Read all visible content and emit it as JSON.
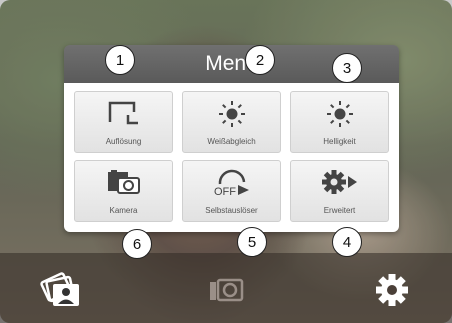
{
  "menu": {
    "title": "Menü",
    "tiles": [
      {
        "label": "Auflösung",
        "icon": "resolution-icon"
      },
      {
        "label": "Weißabgleich",
        "icon": "white-balance-icon"
      },
      {
        "label": "Helligkeit",
        "icon": "brightness-icon"
      },
      {
        "label": "Kamera",
        "icon": "camera-switch-icon"
      },
      {
        "label": "Selbstauslöser",
        "icon": "self-timer-icon",
        "icon_text": "OFF"
      },
      {
        "label": "Erweitert",
        "icon": "advanced-settings-icon"
      }
    ]
  },
  "toolbar": {
    "buttons": [
      {
        "name": "gallery",
        "icon": "gallery-icon"
      },
      {
        "name": "shutter",
        "icon": "camera-icon"
      },
      {
        "name": "settings",
        "icon": "gear-icon"
      }
    ]
  },
  "callouts": [
    "1",
    "2",
    "3",
    "4",
    "5",
    "6"
  ],
  "colors": {
    "header": "#5a5a5a",
    "tile_text": "#555555",
    "icon": "#444444"
  }
}
